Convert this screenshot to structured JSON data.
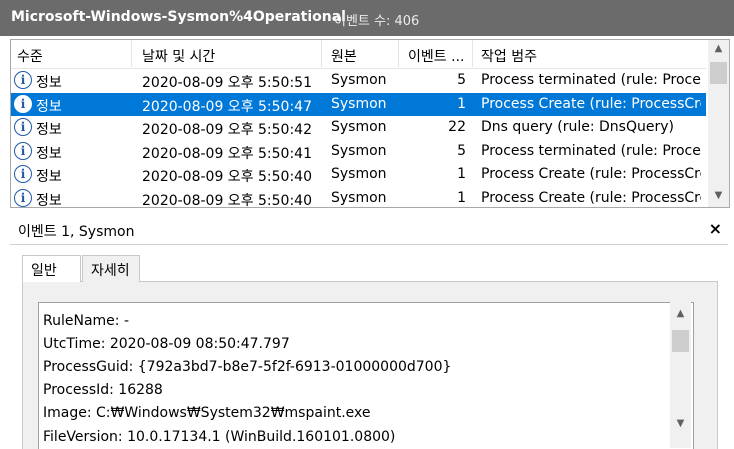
{
  "titlebar": {
    "log_name": "Microsoft-Windows-Sysmon%4Operational",
    "count_label": "이벤트 수:",
    "count_value": "406"
  },
  "columns": [
    "수준",
    "날짜 및 시간",
    "원본",
    "이벤트 ...",
    "작업 범주"
  ],
  "rows": [
    {
      "level": "정보",
      "datetime": "2020-08-09 오후 5:50:51",
      "source": "Sysmon",
      "event_id": "5",
      "category": "Process terminated (rule: Proces..."
    },
    {
      "level": "정보",
      "datetime": "2020-08-09 오후 5:50:47",
      "source": "Sysmon",
      "event_id": "1",
      "category": "Process Create (rule: ProcessCre..."
    },
    {
      "level": "정보",
      "datetime": "2020-08-09 오후 5:50:42",
      "source": "Sysmon",
      "event_id": "22",
      "category": "Dns query (rule: DnsQuery)"
    },
    {
      "level": "정보",
      "datetime": "2020-08-09 오후 5:50:41",
      "source": "Sysmon",
      "event_id": "5",
      "category": "Process terminated (rule: Proces..."
    },
    {
      "level": "정보",
      "datetime": "2020-08-09 오후 5:50:40",
      "source": "Sysmon",
      "event_id": "1",
      "category": "Process Create (rule: ProcessCre..."
    },
    {
      "level": "정보",
      "datetime": "2020-08-09 오후 5:50:40",
      "source": "Sysmon",
      "event_id": "1",
      "category": "Process Create (rule: ProcessCre..."
    }
  ],
  "selected_row": 1,
  "detail": {
    "title": "이벤트 1, Sysmon",
    "close": "×",
    "tabs": [
      "일반",
      "자세히"
    ],
    "lines": [
      "RuleName: -",
      "UtcTime: 2020-08-09 08:50:47.797",
      "ProcessGuid: {792a3bd7-b8e7-5f2f-6913-01000000d700}",
      "ProcessId: 16288",
      "Image: C:₩Windows₩System32₩mspaint.exe",
      "FileVersion: 10.0.17134.1 (WinBuild.160101.0800)"
    ]
  },
  "icons": {
    "level": "info-icon",
    "scroll_up": "chevron-up-icon",
    "scroll_down": "chevron-down-icon",
    "close": "close-icon"
  },
  "colors": {
    "titlebar": "#6b6b6b",
    "selection": "#0078d7",
    "info_icon": "#1f5aa6"
  }
}
